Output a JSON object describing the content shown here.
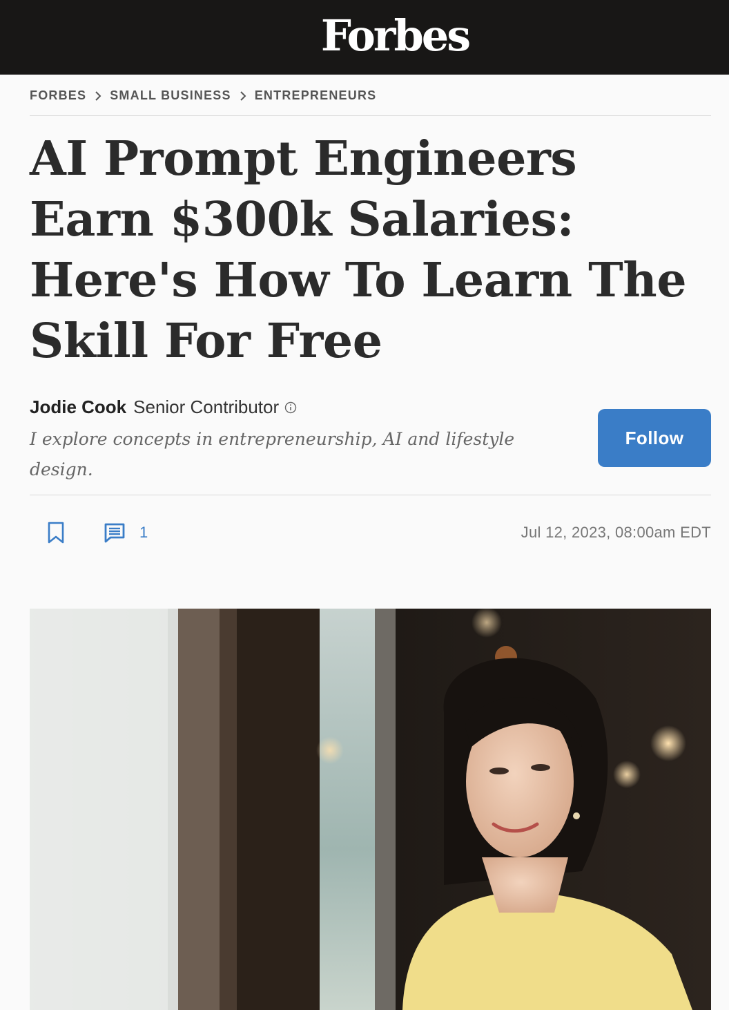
{
  "header": {
    "logo_text": "Forbes",
    "background": "#181716"
  },
  "breadcrumb": {
    "items": [
      "FORBES",
      "SMALL BUSINESS",
      "ENTREPRENEURS"
    ]
  },
  "article": {
    "headline": "AI Prompt Engineers Earn $300k Salaries: Here's How To Learn The Skill For Free",
    "author_name": "Jodie Cook",
    "author_role": "Senior Contributor",
    "author_bio": "I explore concepts in entrepreneurship, AI and lifestyle design.",
    "follow_label": "Follow",
    "comment_count": "1",
    "published": "Jul 12, 2023, 08:00am EDT"
  },
  "icons": {
    "separator": "chevron-right-icon",
    "info": "info-icon",
    "bookmark": "bookmark-icon",
    "comment": "comment-icon"
  },
  "colors": {
    "accent": "#3a7dc7",
    "text": "#2b2b2b"
  }
}
